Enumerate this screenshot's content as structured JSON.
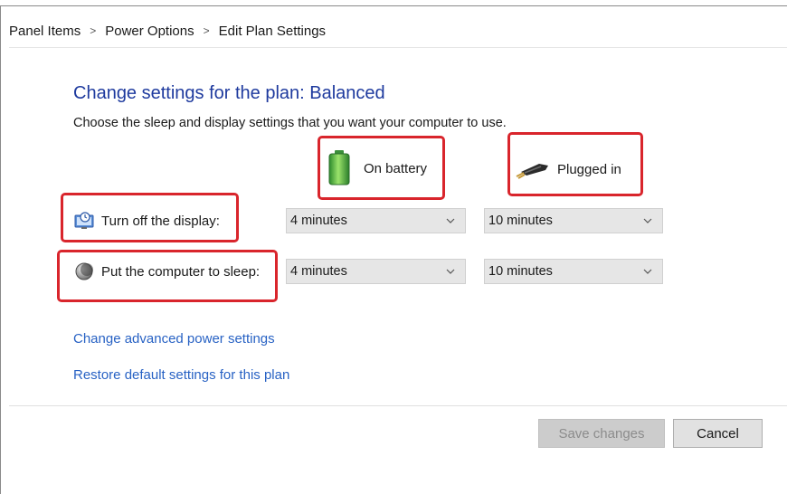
{
  "breadcrumb": {
    "items": [
      "Panel Items",
      "Power Options",
      "Edit Plan Settings"
    ],
    "separator": ">"
  },
  "page": {
    "title": "Change settings for the plan: Balanced",
    "subtitle": "Choose the sleep and display settings that you want your computer to use."
  },
  "columns": {
    "battery": {
      "label": "On battery",
      "icon": "battery-icon"
    },
    "plugged": {
      "label": "Plugged in",
      "icon": "power-plug-icon"
    }
  },
  "rows": {
    "display": {
      "label": "Turn off the display:",
      "icon": "monitor-clock-icon",
      "battery_value": "4 minutes",
      "plugged_value": "10 minutes"
    },
    "sleep": {
      "label": "Put the computer to sleep:",
      "icon": "moon-icon",
      "battery_value": "4 minutes",
      "plugged_value": "10 minutes"
    }
  },
  "links": {
    "advanced": "Change advanced power settings",
    "restore": "Restore default settings for this plan"
  },
  "buttons": {
    "save": {
      "label": "Save changes",
      "enabled": false
    },
    "cancel": {
      "label": "Cancel"
    }
  },
  "colors": {
    "title": "#1e3a9e",
    "link": "#2862c4",
    "highlight": "#d9252c"
  }
}
